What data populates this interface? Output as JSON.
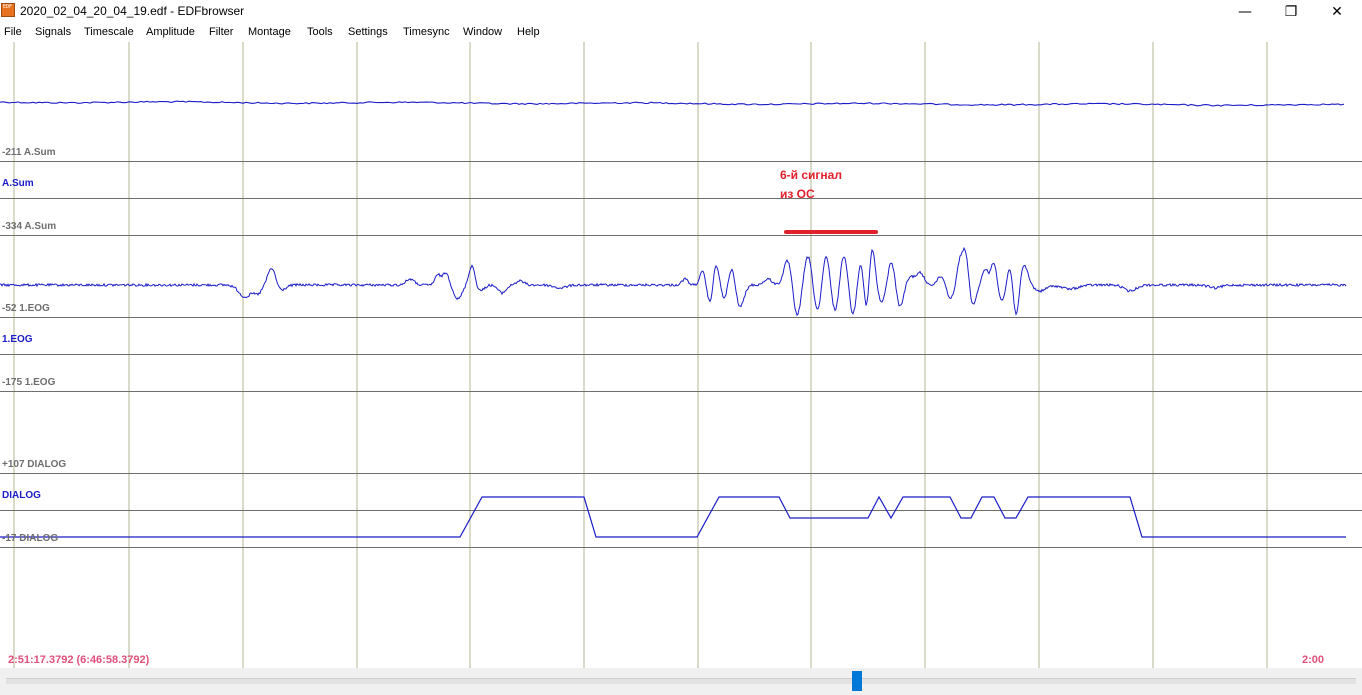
{
  "window": {
    "title": "2020_02_04_20_04_19.edf - EDFbrowser",
    "icon": "edfbrowser-icon",
    "icon_text": "EDF",
    "minimize_glyph": "—",
    "maximize_glyph": "❐",
    "close_glyph": "✕"
  },
  "menu": [
    {
      "label": "File"
    },
    {
      "label": "Signals"
    },
    {
      "label": "Timescale"
    },
    {
      "label": "Amplitude"
    },
    {
      "label": "Filter"
    },
    {
      "label": "Montage"
    },
    {
      "label": "Tools"
    },
    {
      "label": "Settings"
    },
    {
      "label": "Timesync"
    },
    {
      "label": "Window"
    },
    {
      "label": "Help"
    }
  ],
  "signals": [
    {
      "name": "A.Sum",
      "top_value": "-211 A.Sum",
      "bottom_value": "-334 A.Sum"
    },
    {
      "name": "1.EOG",
      "top_value": "-52 1.EOG",
      "bottom_value": "-175 1.EOG"
    },
    {
      "name": "DIALOG",
      "top_value": "+107 DIALOG",
      "bottom_value": "-17 DIALOG"
    }
  ],
  "annotation": {
    "line1": "6-й сигнал",
    "line2": "из ОС",
    "color": "#e0202a"
  },
  "footer": {
    "start_time": "2:51:17.3792 (6:46:58.3792)",
    "page_duration": "2:00"
  },
  "colors": {
    "trace": "#1c1cc8",
    "grid_vertical": "#b4b496",
    "grid_horizontal": "#6e6e6e",
    "scroll_thumb": "#0078d7"
  }
}
